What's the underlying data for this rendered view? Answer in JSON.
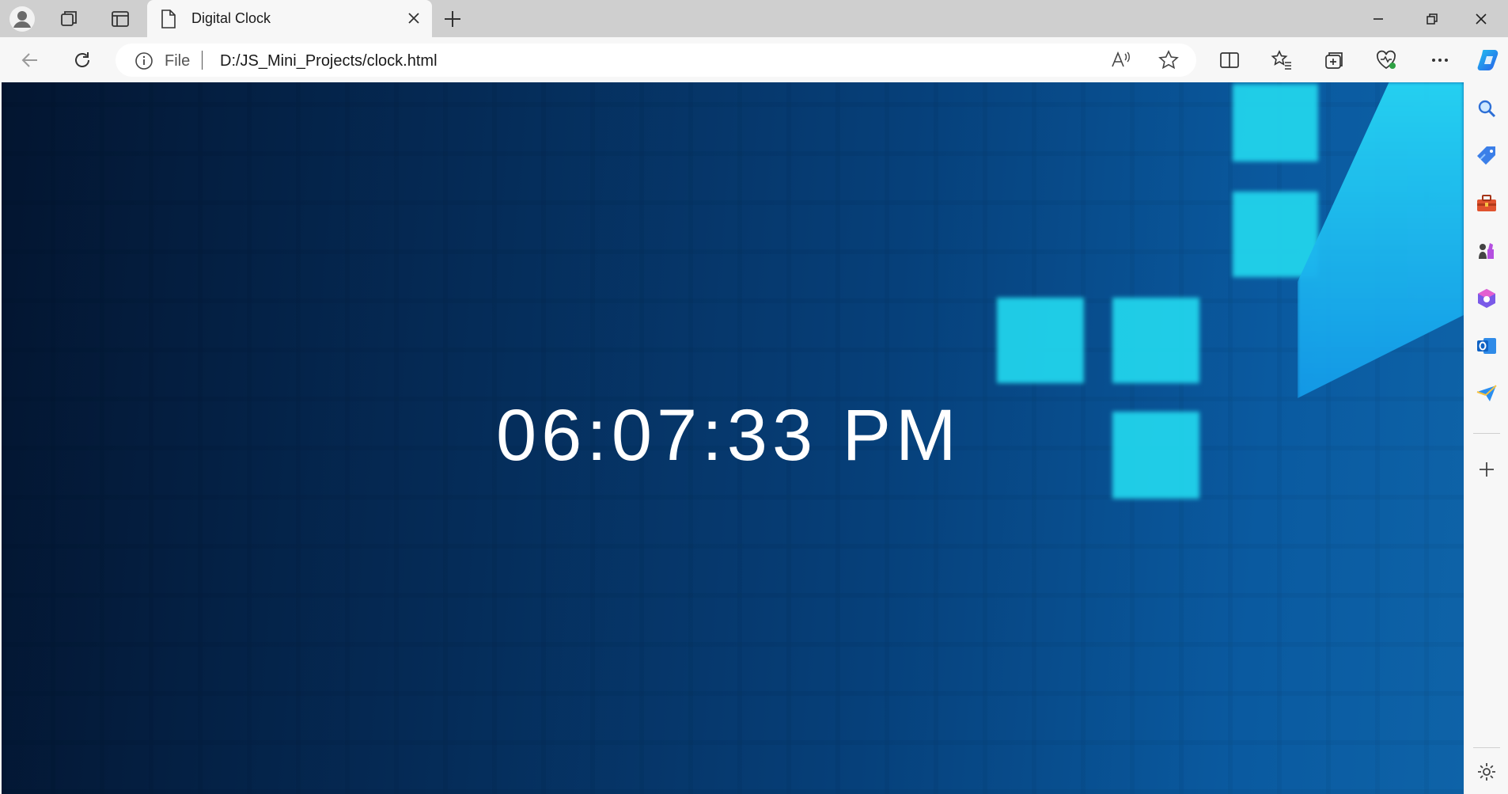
{
  "browser": {
    "tab": {
      "title": "Digital Clock"
    },
    "address": {
      "scheme": "File",
      "url": "D:/JS_Mini_Projects/clock.html"
    },
    "window_buttons": [
      "minimize",
      "restore",
      "close"
    ]
  },
  "page": {
    "clock_text": "06:07:33 PM"
  },
  "sidebar": {
    "items": [
      "search-icon",
      "tag-icon",
      "toolbox-icon",
      "chess-icon",
      "office-icon",
      "outlook-icon",
      "send-icon",
      "add-icon",
      "settings-icon"
    ]
  },
  "colors": {
    "accent": "#22d7ee",
    "background_dark": "#031530",
    "background_light": "#0e63a8",
    "text": "#ffffff"
  }
}
